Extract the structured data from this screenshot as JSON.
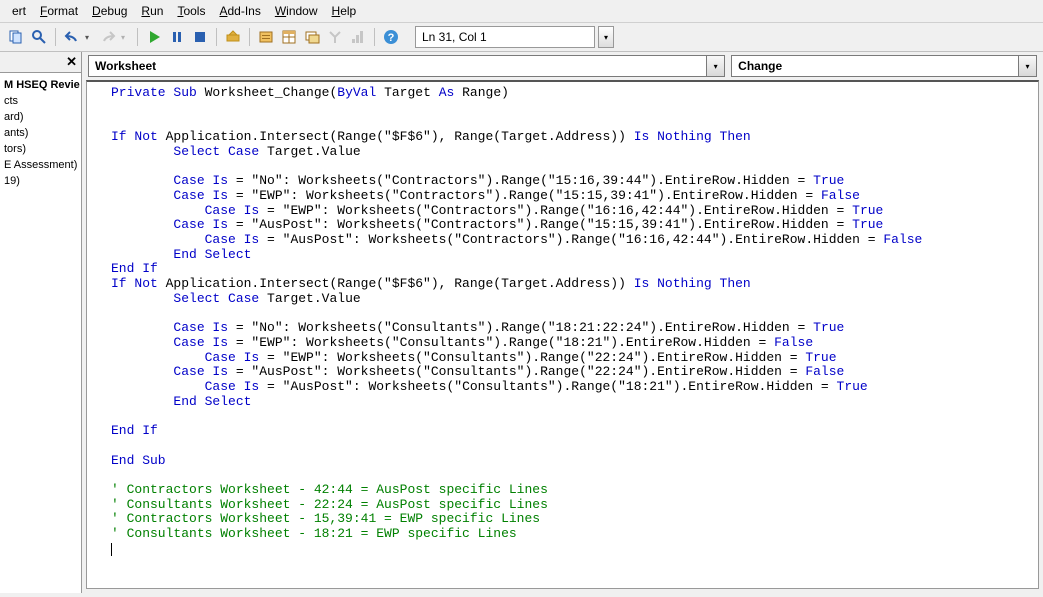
{
  "menu": {
    "items": [
      "ert",
      "Format",
      "Debug",
      "Run",
      "Tools",
      "Add-Ins",
      "Window",
      "Help"
    ],
    "accel": [
      -1,
      0,
      0,
      0,
      0,
      0,
      0,
      0
    ]
  },
  "toolbar": {
    "cursor_pos": "Ln 31, Col 1",
    "icons": [
      "copy-icon",
      "find-icon",
      "undo-icon",
      "redo-icon",
      "run-icon",
      "break-icon",
      "reset-icon",
      "design-icon",
      "project-icon",
      "properties-icon",
      "browser-icon",
      "toolbox-icon",
      "priority-icon",
      "help-icon"
    ]
  },
  "project_tree": {
    "items": [
      "M HSEQ Revie",
      "cts",
      "ard)",
      "ants)",
      "tors)",
      "E Assessment)",
      "19)"
    ]
  },
  "dropdowns": {
    "left": "Worksheet",
    "right": "Change"
  },
  "code": {
    "lines": [
      {
        "t": "code",
        "segs": [
          [
            "kw",
            "Private Sub"
          ],
          [
            "txt",
            " Worksheet_Change("
          ],
          [
            "kw",
            "ByVal"
          ],
          [
            "txt",
            " Target "
          ],
          [
            "kw",
            "As"
          ],
          [
            "txt",
            " Range)"
          ]
        ]
      },
      {
        "t": "blank"
      },
      {
        "t": "blank"
      },
      {
        "t": "code",
        "segs": [
          [
            "kw",
            "If Not"
          ],
          [
            "txt",
            " Application.Intersect(Range(\"$F$6\"), Range(Target.Address)) "
          ],
          [
            "kw",
            "Is Nothing Then"
          ]
        ]
      },
      {
        "t": "code",
        "segs": [
          [
            "txt",
            "        "
          ],
          [
            "kw",
            "Select Case"
          ],
          [
            "txt",
            " Target.Value"
          ]
        ]
      },
      {
        "t": "blank"
      },
      {
        "t": "code",
        "segs": [
          [
            "txt",
            "        "
          ],
          [
            "kw",
            "Case Is"
          ],
          [
            "txt",
            " = \"No\": Worksheets(\"Contractors\").Range(\"15:16,39:44\").EntireRow.Hidden = "
          ],
          [
            "kw",
            "True"
          ]
        ]
      },
      {
        "t": "code",
        "segs": [
          [
            "txt",
            "        "
          ],
          [
            "kw",
            "Case Is"
          ],
          [
            "txt",
            " = \"EWP\": Worksheets(\"Contractors\").Range(\"15:15,39:41\").EntireRow.Hidden = "
          ],
          [
            "kw",
            "False"
          ]
        ]
      },
      {
        "t": "code",
        "segs": [
          [
            "txt",
            "            "
          ],
          [
            "kw",
            "Case Is"
          ],
          [
            "txt",
            " = \"EWP\": Worksheets(\"Contractors\").Range(\"16:16,42:44\").EntireRow.Hidden = "
          ],
          [
            "kw",
            "True"
          ]
        ]
      },
      {
        "t": "code",
        "segs": [
          [
            "txt",
            "        "
          ],
          [
            "kw",
            "Case Is"
          ],
          [
            "txt",
            " = \"AusPost\": Worksheets(\"Contractors\").Range(\"15:15,39:41\").EntireRow.Hidden = "
          ],
          [
            "kw",
            "True"
          ]
        ]
      },
      {
        "t": "code",
        "segs": [
          [
            "txt",
            "            "
          ],
          [
            "kw",
            "Case Is"
          ],
          [
            "txt",
            " = \"AusPost\": Worksheets(\"Contractors\").Range(\"16:16,42:44\").EntireRow.Hidden = "
          ],
          [
            "kw",
            "False"
          ]
        ]
      },
      {
        "t": "code",
        "segs": [
          [
            "txt",
            "        "
          ],
          [
            "kw",
            "End Select"
          ]
        ]
      },
      {
        "t": "code",
        "segs": [
          [
            "kw",
            "End If"
          ]
        ]
      },
      {
        "t": "code",
        "segs": [
          [
            "kw",
            "If Not"
          ],
          [
            "txt",
            " Application.Intersect(Range(\"$F$6\"), Range(Target.Address)) "
          ],
          [
            "kw",
            "Is Nothing Then"
          ]
        ]
      },
      {
        "t": "code",
        "segs": [
          [
            "txt",
            "        "
          ],
          [
            "kw",
            "Select Case"
          ],
          [
            "txt",
            " Target.Value"
          ]
        ]
      },
      {
        "t": "blank"
      },
      {
        "t": "code",
        "segs": [
          [
            "txt",
            "        "
          ],
          [
            "kw",
            "Case Is"
          ],
          [
            "txt",
            " = \"No\": Worksheets(\"Consultants\").Range(\"18:21:22:24\").EntireRow.Hidden = "
          ],
          [
            "kw",
            "True"
          ]
        ]
      },
      {
        "t": "code",
        "segs": [
          [
            "txt",
            "        "
          ],
          [
            "kw",
            "Case Is"
          ],
          [
            "txt",
            " = \"EWP\": Worksheets(\"Consultants\").Range(\"18:21\").EntireRow.Hidden = "
          ],
          [
            "kw",
            "False"
          ]
        ]
      },
      {
        "t": "code",
        "segs": [
          [
            "txt",
            "            "
          ],
          [
            "kw",
            "Case Is"
          ],
          [
            "txt",
            " = \"EWP\": Worksheets(\"Consultants\").Range(\"22:24\").EntireRow.Hidden = "
          ],
          [
            "kw",
            "True"
          ]
        ]
      },
      {
        "t": "code",
        "segs": [
          [
            "txt",
            "        "
          ],
          [
            "kw",
            "Case Is"
          ],
          [
            "txt",
            " = \"AusPost\": Worksheets(\"Consultants\").Range(\"22:24\").EntireRow.Hidden = "
          ],
          [
            "kw",
            "False"
          ]
        ]
      },
      {
        "t": "code",
        "segs": [
          [
            "txt",
            "            "
          ],
          [
            "kw",
            "Case Is"
          ],
          [
            "txt",
            " = \"AusPost\": Worksheets(\"Consultants\").Range(\"18:21\").EntireRow.Hidden = "
          ],
          [
            "kw",
            "True"
          ]
        ]
      },
      {
        "t": "code",
        "segs": [
          [
            "txt",
            "        "
          ],
          [
            "kw",
            "End Select"
          ]
        ]
      },
      {
        "t": "blank"
      },
      {
        "t": "code",
        "segs": [
          [
            "kw",
            "End If"
          ]
        ]
      },
      {
        "t": "blank"
      },
      {
        "t": "code",
        "segs": [
          [
            "kw",
            "End Sub"
          ]
        ]
      },
      {
        "t": "blank"
      },
      {
        "t": "code",
        "segs": [
          [
            "cm",
            "' Contractors Worksheet - 42:44 = AusPost specific Lines"
          ]
        ]
      },
      {
        "t": "code",
        "segs": [
          [
            "cm",
            "' Consultants Worksheet - 22:24 = AusPost specific Lines"
          ]
        ]
      },
      {
        "t": "code",
        "segs": [
          [
            "cm",
            "' Contractors Worksheet - 15,39:41 = EWP specific Lines"
          ]
        ]
      },
      {
        "t": "code",
        "segs": [
          [
            "cm",
            "' Consultants Worksheet - 18:21 = EWP specific Lines"
          ]
        ]
      },
      {
        "t": "caret"
      }
    ]
  }
}
